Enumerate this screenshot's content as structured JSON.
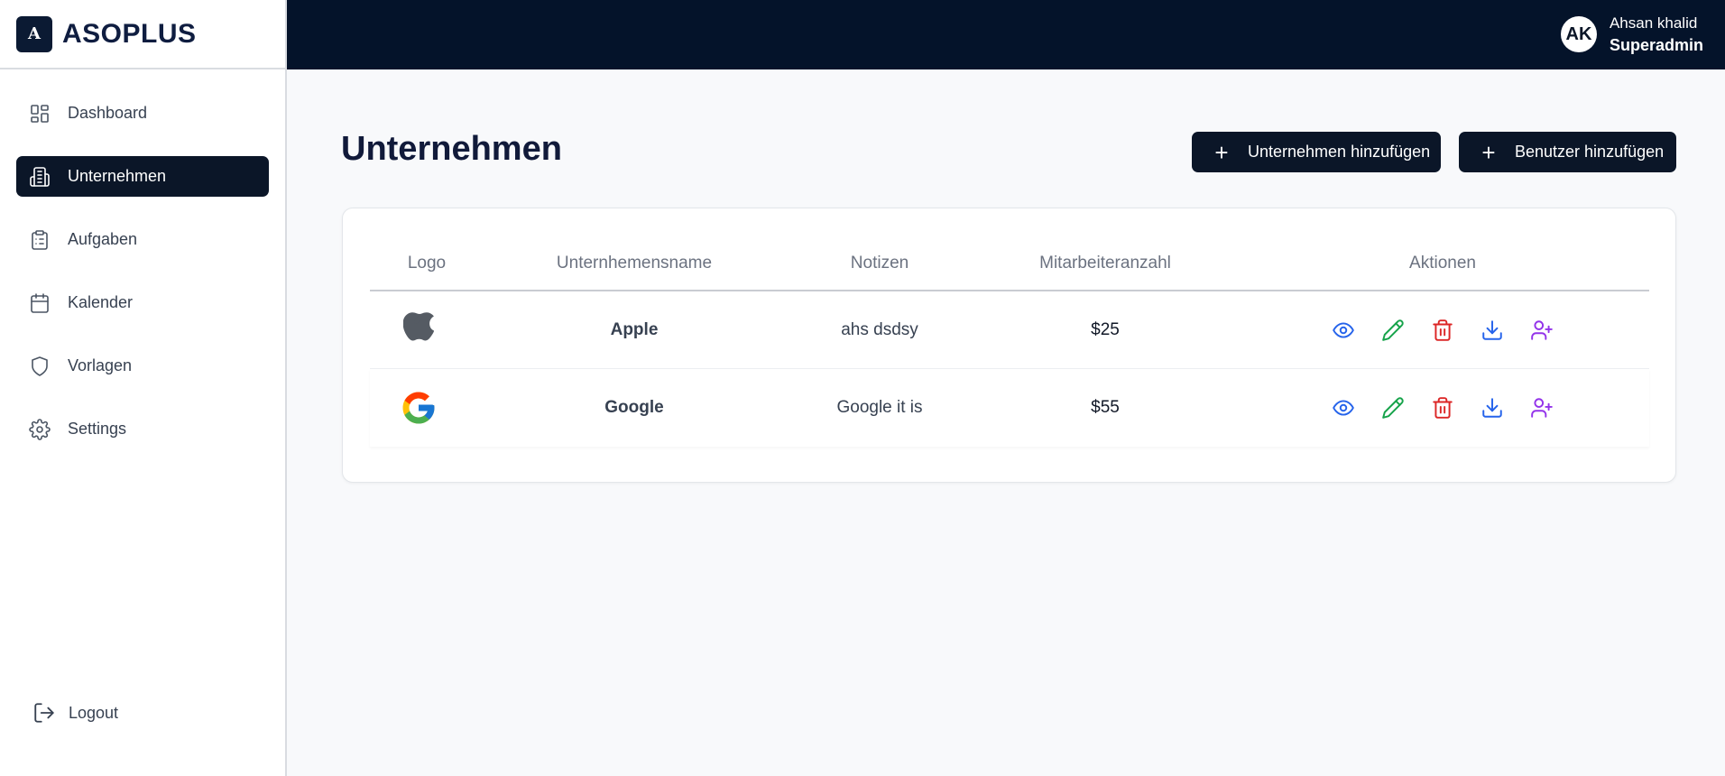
{
  "app": {
    "brand_mark": "A",
    "brand_name": "ASOPLUS"
  },
  "sidebar": {
    "items": [
      {
        "label": "Dashboard",
        "icon": "dashboard-icon"
      },
      {
        "label": "Unternehmen",
        "icon": "building-icon",
        "active": true
      },
      {
        "label": "Aufgaben",
        "icon": "clipboard-icon"
      },
      {
        "label": "Kalender",
        "icon": "calendar-icon"
      },
      {
        "label": "Vorlagen",
        "icon": "shield-icon"
      },
      {
        "label": "Settings",
        "icon": "gear-icon"
      }
    ],
    "logout": "Logout"
  },
  "topbar": {
    "avatar_initials": "AK",
    "user_name": "Ahsan khalid",
    "user_role": "Superadmin"
  },
  "main": {
    "title": "Unternehmen",
    "add_company_label": "Unternehmen hinzufügen",
    "add_user_label": "Benutzer hinzufügen"
  },
  "table": {
    "headers": [
      "Logo",
      "Unternhemensname",
      "Notizen",
      "Mitarbeiteranzahl",
      "Aktionen"
    ],
    "rows": [
      {
        "logo": "apple-logo-icon",
        "name": "Apple",
        "notes": "ahs dsdsy",
        "count": "$25"
      },
      {
        "logo": "google-logo-icon",
        "name": "Google",
        "notes": "Google it is",
        "count": "$55"
      }
    ]
  },
  "colors": {
    "sidebar_active_bg": "#0b1628",
    "topbar_bg": "#04132a",
    "view": "#2563eb",
    "edit": "#16a34a",
    "delete": "#dc2626",
    "download": "#2563eb",
    "add_user": "#9333ea"
  }
}
